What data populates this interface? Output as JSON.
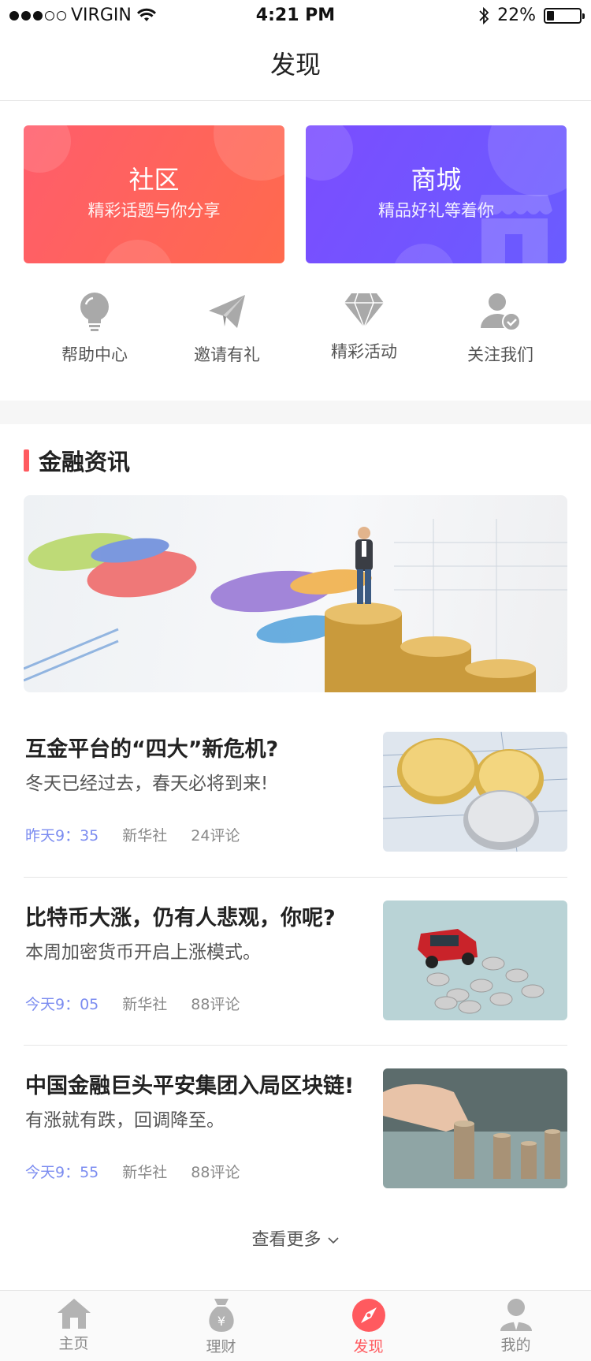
{
  "status_bar": {
    "carrier": "VIRGIN",
    "signal_bars_on": 3,
    "signal_bars_total": 5,
    "time": "4:21 PM",
    "battery": "22%",
    "battery_level": 0.22
  },
  "nav": {
    "title": "发现"
  },
  "banners": {
    "community": {
      "title": "社区",
      "subtitle": "精彩话题与你分享",
      "color_from": "#ff5d6b",
      "color_to": "#ff6a4d"
    },
    "mall": {
      "title": "商城",
      "subtitle": "精品好礼等着你",
      "color_from": "#7b4dff",
      "color_to": "#6a5cff"
    }
  },
  "quick_entries": [
    {
      "label": "帮助中心",
      "icon": "lightbulb-icon"
    },
    {
      "label": "邀请有礼",
      "icon": "paper-plane-icon"
    },
    {
      "label": "精彩活动",
      "icon": "diamond-icon"
    },
    {
      "label": "关注我们",
      "icon": "user-check-icon"
    }
  ],
  "section": {
    "title": "金融资讯",
    "accent": "#ff5a5f"
  },
  "news": [
    {
      "title": "互金平台的“四大”新危机?",
      "desc": "冬天已经过去，春天必将到来!",
      "time": "昨天9：35",
      "source": "新华社",
      "comments": "24评论"
    },
    {
      "title": "比特币大涨，仍有人悲观，你呢?",
      "desc": "本周加密货币开启上涨模式。",
      "time": "今天9：05",
      "source": "新华社",
      "comments": "88评论"
    },
    {
      "title": "中国金融巨头平安集团入局区块链!",
      "desc": "有涨就有跌，回调降至。",
      "time": "今天9：55",
      "source": "新华社",
      "comments": "88评论"
    }
  ],
  "more": {
    "label": "查看更多"
  },
  "tabbar": [
    {
      "label": "主页",
      "icon": "home-icon",
      "active": false
    },
    {
      "label": "理财",
      "icon": "money-bag-icon",
      "active": false
    },
    {
      "label": "发现",
      "icon": "compass-icon",
      "active": true
    },
    {
      "label": "我的",
      "icon": "user-icon",
      "active": false
    }
  ],
  "colors": {
    "time_text": "#7b8cf0",
    "active_tab": "#ff5a5f"
  }
}
